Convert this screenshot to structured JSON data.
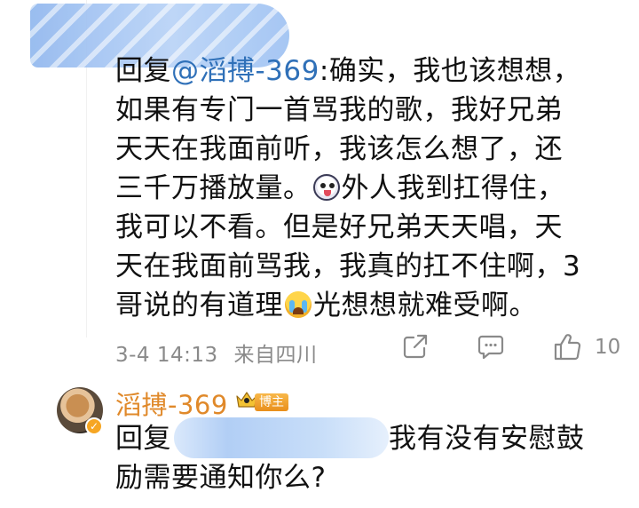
{
  "comment": {
    "reply_prefix": "回复",
    "mention": "@滔搏-369",
    "lines": [
      "确实，我也该想想，",
      "如果有专门一首骂我的歌，我好兄弟",
      "天天在我面前听，我该怎么想了，还",
      "三千万播放量。",
      "外人我到扛得住，",
      "我可以不看。但是好兄弟天天唱，天",
      "天在我面前骂我，我真的扛不住啊，3",
      "哥说的有道理",
      "光想想就难受啊。"
    ],
    "emoji_1": "skull-emoji",
    "emoji_2": "crying-emoji"
  },
  "meta": {
    "time": "3-4 14:13",
    "location": "来自四川",
    "like_count": "10"
  },
  "reply": {
    "name": "滔搏-369",
    "badge": "博主",
    "prefix": "回复",
    "text_line1": "我有没有安慰鼓",
    "text_line2": "励需要通知你么?"
  },
  "colors": {
    "name": "#e0892a",
    "mention": "#2f70b8",
    "meta": "#8a8a8a"
  }
}
